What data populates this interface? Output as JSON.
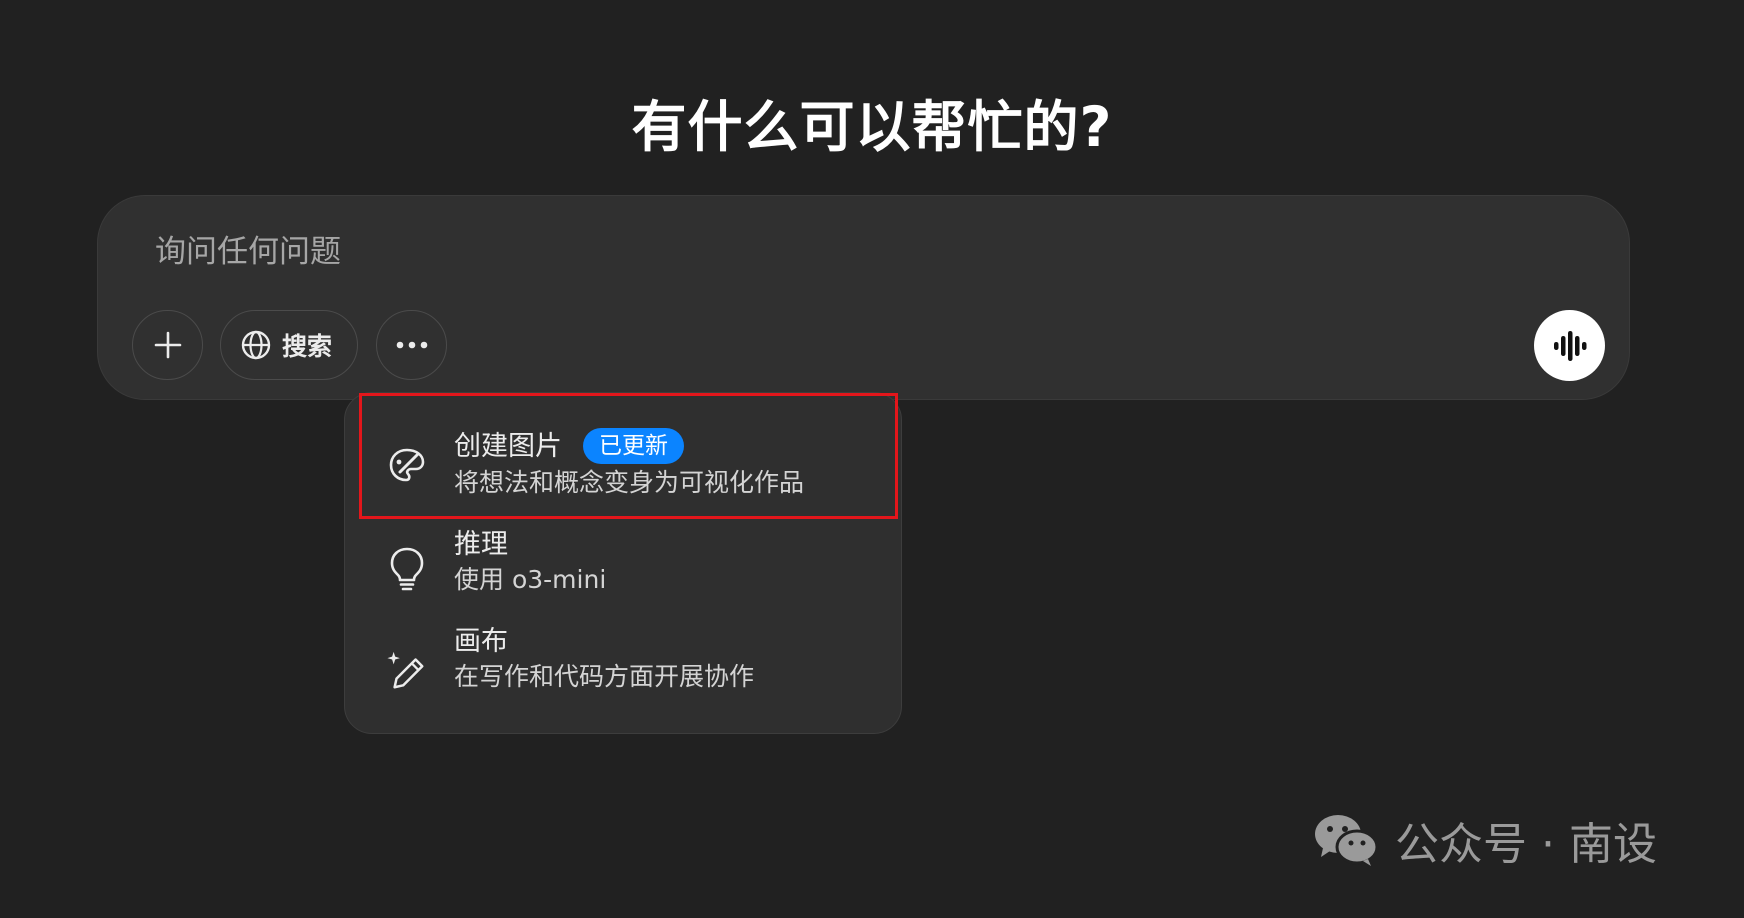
{
  "heading": "有什么可以帮忙的?",
  "composer": {
    "placeholder": "询问任何问题",
    "search_label": "搜索"
  },
  "tools_menu": {
    "items": [
      {
        "title": "创建图片",
        "badge": "已更新",
        "description": "将想法和概念变身为可视化作品",
        "icon": "paint-palette-icon"
      },
      {
        "title": "推理",
        "description": "使用 o3-mini",
        "icon": "lightbulb-icon"
      },
      {
        "title": "画布",
        "description": "在写作和代码方面开展协作",
        "icon": "sparkle-pencil-icon"
      }
    ]
  },
  "watermark": {
    "text": "公众号 · 南设",
    "icon": "wechat-icon"
  },
  "colors": {
    "background": "#212121",
    "composer": "#303030",
    "menu": "#2f2f2f",
    "badge": "#0b84ff",
    "highlight": "#e3161b"
  }
}
